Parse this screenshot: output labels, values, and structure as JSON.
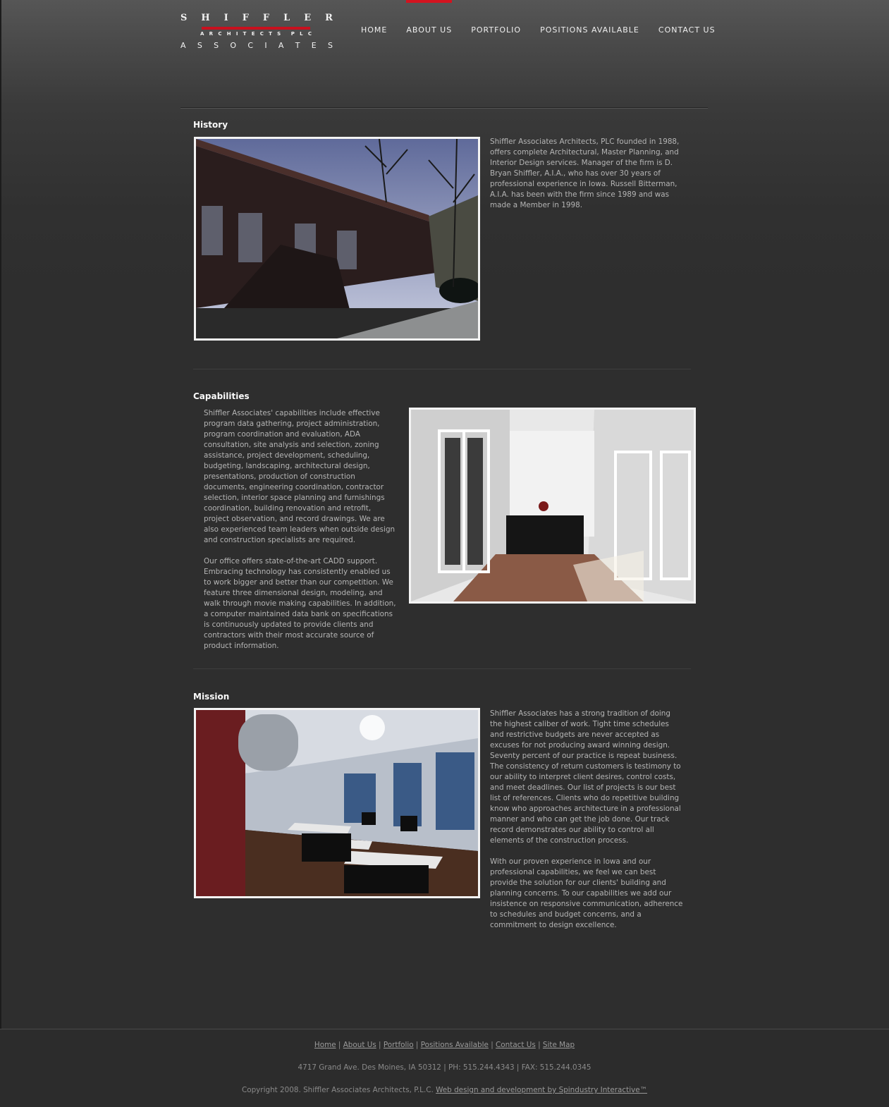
{
  "logo": {
    "top_letters": [
      "S",
      "H",
      "I",
      "F",
      "F",
      "L",
      "E",
      "R"
    ],
    "middle_letters": [
      "A",
      "R",
      "C",
      "H",
      "I",
      "T",
      "E",
      "C",
      "T",
      "S",
      " ",
      "P",
      "L",
      "C"
    ],
    "bottom_letters": [
      "A",
      "S",
      "S",
      "O",
      "C",
      "I",
      "A",
      "T",
      "E",
      "S"
    ],
    "accent_color": "#c8101e"
  },
  "nav": {
    "items": [
      {
        "label": "HOME"
      },
      {
        "label": "ABOUT US",
        "active": true
      },
      {
        "label": "PORTFOLIO"
      },
      {
        "label": "POSITIONS AVAILABLE"
      },
      {
        "label": "CONTACT US"
      }
    ]
  },
  "sections": {
    "history": {
      "heading": "History",
      "paragraphs": [
        "Shiffler Associates Architects, PLC founded in 1988, offers complete Architectural, Master Planning, and Interior Design services. Manager of the firm is D. Bryan Shiffler, A.I.A., who has over 30 years of professional experience in Iowa. Russell Bitterman, A.I.A. has been with the firm since 1989 and was made a Member in 1998."
      ]
    },
    "capabilities": {
      "heading": "Capabilities",
      "paragraphs": [
        "Shiffler Associates' capabilities include effective program data gathering, project administration, program coordination and evaluation, ADA consultation, site analysis and selection, zoning assistance, project development, scheduling, budgeting, landscaping, architectural design, presentations, production of construction documents, engineering coordination, contractor selection, interior space planning and furnishings coordination, building renovation and retrofit, project observation, and record drawings. We are also experienced team leaders when outside design and construction specialists are required.",
        "Our office offers state-of-the-art CADD support. Embracing technology has consistently enabled us to work bigger and better than our competition. We feature three dimensional design, modeling, and walk through movie making capabilities. In addition, a computer maintained data bank on specifications is continuously updated to provide clients and contractors with their most accurate source of product information."
      ]
    },
    "mission": {
      "heading": "Mission",
      "paragraphs": [
        "Shiffler Associates has a strong tradition of doing the highest caliber of work. Tight time schedules and restrictive budgets are never accepted as excuses for not producing award winning design. Seventy percent of our practice is repeat business. The consistency of return customers is testimony to our ability to interpret client desires, control costs, and meet deadlines. Our list of projects is our best list of references. Clients who do repetitive building know who approaches architecture in a professional manner and who can get the job done. Our track record demonstrates our ability to control all elements of the construction process.",
        "With our proven experience in Iowa and our professional capabilities, we feel we can best provide the solution for our clients' building and planning concerns. To our capabilities we add our insistence on responsive communication, adherence to schedules and budget concerns, and a commitment to design excellence."
      ]
    }
  },
  "footer": {
    "links": [
      "Home",
      "About Us",
      "Portfolio",
      "Positions Available",
      "Contact Us",
      "Site Map"
    ],
    "address": "4717 Grand Ave. Des Moines, IA 50312 | PH: 515.244.4343 | FAX: 515.244.0345",
    "copyright": "Copyright 2008. Shiffler Associates Architects, P.L.C.",
    "credit_link": "Web design and development by Spindustry Interactive™"
  }
}
